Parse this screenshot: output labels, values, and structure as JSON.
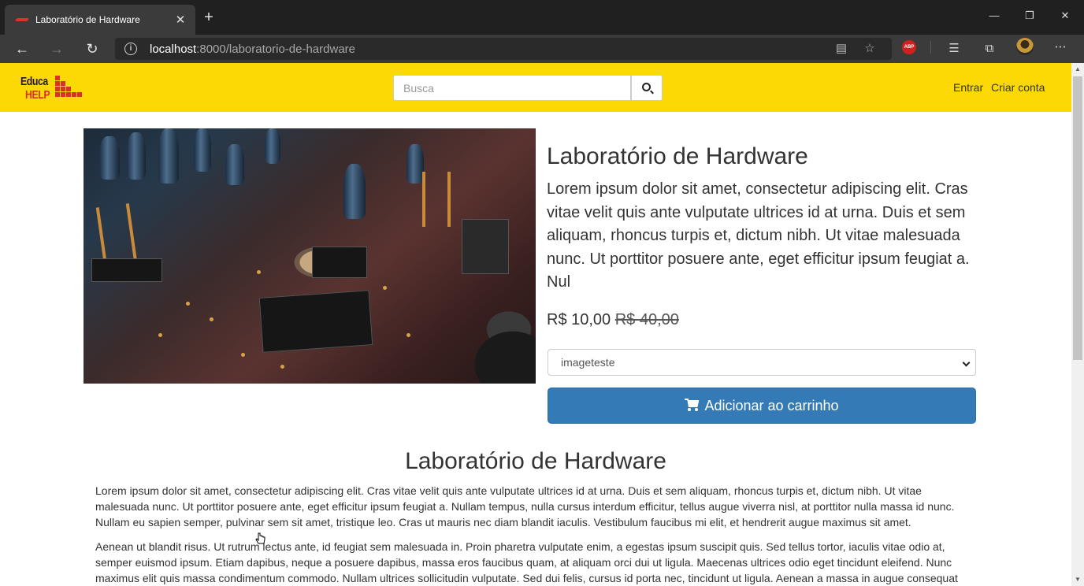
{
  "browser": {
    "tab_title": "Laboratório de Hardware",
    "url_host": "localhost",
    "url_rest": ":8000/laboratorio-de-hardware"
  },
  "header": {
    "logo_line1": "Educa",
    "logo_line2": "HELP",
    "search_placeholder": "Busca",
    "login_label": "Entrar",
    "signup_label": "Criar conta",
    "background_color": "#fcd905"
  },
  "product": {
    "title": "Laboratório de Hardware",
    "description": "Lorem ipsum dolor sit amet, consectetur adipiscing elit. Cras vitae velit quis ante vulputate ultrices id at urna. Duis et sem aliquam, rhoncus turpis et, dictum nibh. Ut vitae malesuada nunc. Ut porttitor posuere ante, eget efficitur ipsum feugiat a. Nul",
    "price": "R$ 10,00",
    "old_price": "R$ 40,00",
    "variant_selected": "imageteste",
    "add_to_cart_label": "Adicionar ao carrinho",
    "button_color": "#337ab7"
  },
  "details": {
    "title": "Laboratório de Hardware",
    "paragraphs": [
      "Lorem ipsum dolor sit amet, consectetur adipiscing elit. Cras vitae velit quis ante vulputate ultrices id at urna. Duis et sem aliquam, rhoncus turpis et, dictum nibh. Ut vitae malesuada nunc. Ut porttitor posuere ante, eget efficitur ipsum feugiat a. Nullam tempus, nulla cursus interdum efficitur, tellus augue viverra nisl, at porttitor nulla massa id nunc. Nullam eu sapien semper, pulvinar sem sit amet, tristique leo. Cras ut mauris nec diam blandit iaculis. Vestibulum faucibus mi elit, et hendrerit augue maximus sit amet.",
      "Aenean ut blandit risus. Ut rutrum lectus ante, id feugiat sem malesuada in. Proin pharetra vulputate enim, a egestas ipsum suscipit quis. Sed tellus tortor, iaculis vitae odio at, semper euismod ipsum. Etiam dapibus, neque a posuere dapibus, massa eros faucibus quam, at aliquam orci dui ut ligula. Maecenas ultrices odio eget tincidunt eleifend. Nunc maximus elit quis massa condimentum commodo. Nullam ultrices sollicitudin vulputate. Sed dui felis, cursus id porta nec, tincidunt ut ligula. Aenean a massa in augue consequat"
    ]
  }
}
